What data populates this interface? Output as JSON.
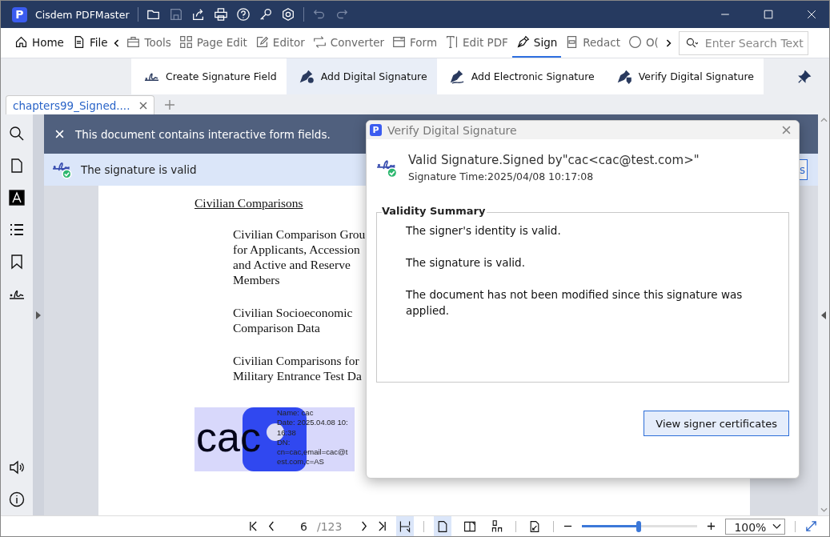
{
  "window": {
    "logo": "P",
    "title": "Cisdem PDFMaster"
  },
  "menu": [
    {
      "label": "Home",
      "selected": false,
      "dim": false
    },
    {
      "label": "File",
      "selected": false,
      "dim": false
    },
    {
      "label": "Tools",
      "selected": false,
      "dim": true
    },
    {
      "label": "Page Edit",
      "selected": false,
      "dim": true
    },
    {
      "label": "Editor",
      "selected": false,
      "dim": true
    },
    {
      "label": "Converter",
      "selected": false,
      "dim": true
    },
    {
      "label": "Form",
      "selected": false,
      "dim": true
    },
    {
      "label": "Edit PDF",
      "selected": false,
      "dim": true
    },
    {
      "label": "Sign",
      "selected": true,
      "dim": false
    },
    {
      "label": "Redact",
      "selected": false,
      "dim": true
    },
    {
      "label": "O(",
      "selected": false,
      "dim": true
    }
  ],
  "search": {
    "placeholder": "Enter Search Text"
  },
  "sign_tools": [
    {
      "label": "Create Signature Field",
      "selected": false
    },
    {
      "label": "Add Digital Signature",
      "selected": true
    },
    {
      "label": "Add Electronic Signature",
      "selected": false
    },
    {
      "label": "Verify Digital Signature",
      "selected": false
    }
  ],
  "tabs": [
    {
      "label": "chapters99_Signed....",
      "selected": true
    }
  ],
  "form_notice": "This document contains interactive form fields.",
  "signature_banner": {
    "text": "The signature is valid",
    "button_partial": "s"
  },
  "document": {
    "heading": "Civilian Comparisons",
    "paragraphs": [
      [
        "Civilian Comparison Grou",
        "for Applicants, Accession",
        "and Active and Reserve",
        "Members"
      ],
      [
        "Civilian Socioeconomic",
        "Comparison Data"
      ],
      [
        "Civilian Comparisons for",
        "Military Entrance Test Da"
      ]
    ],
    "signature_stamp": {
      "name": "cac",
      "details": [
        "Name: cac",
        "Date: 2025.04.08 10:",
        "16:38",
        "DN:",
        "cn=cac,email=cac@t",
        "est.com,c=AS"
      ]
    }
  },
  "dialog": {
    "logo": "P",
    "title": "Verify Digital Signature",
    "status": "Valid Signature.Signed by\"cac<cac@test.com>\"",
    "time": "Signature Time:2025/04/08 10:17:08",
    "summary_title": "Validity Summary",
    "summary": [
      "The signer's identity is valid.",
      "The signature is valid.",
      "The document has not been modified since this signature was applied."
    ],
    "button": "View signer certificates"
  },
  "status_bar": {
    "page": "6",
    "total": "/123",
    "level": 0.49,
    "zoom": "100%",
    "fit_width_selected": true,
    "single_page_selected": true
  }
}
